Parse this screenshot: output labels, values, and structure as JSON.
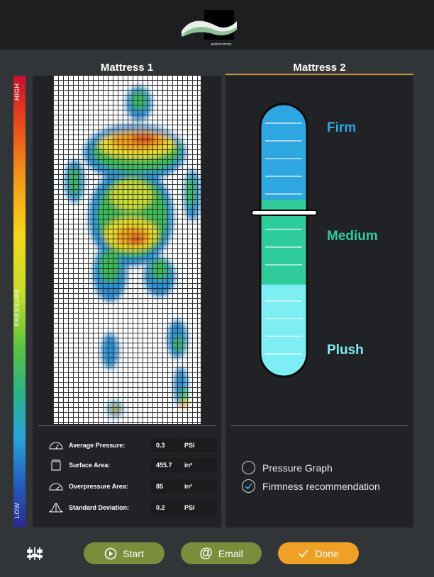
{
  "brand": {
    "logo_text": "BODYFITTER",
    "logo_icon": "bodyfitter-wave-logo"
  },
  "mattress1": {
    "title": "Mattress 1"
  },
  "mattress2": {
    "title": "Mattress 2"
  },
  "legend": {
    "high": "HIGH",
    "pressure": "PRESSURE",
    "low": "LOW"
  },
  "stats": [
    {
      "label": "Average Pressure:",
      "value": "0.3",
      "unit": "PSI",
      "icon": "gauge-icon"
    },
    {
      "label": "Surface Area:",
      "value": "455.7",
      "unit": "in²",
      "icon": "area-icon"
    },
    {
      "label": "Overpressure Area:",
      "value": "85",
      "unit": "in²",
      "icon": "gauge-icon"
    },
    {
      "label": "Standard Deviation:",
      "value": "0.2",
      "unit": "PSI",
      "icon": "bell-curve-icon"
    }
  ],
  "firmness": {
    "levels": [
      "Firm",
      "Medium",
      "Plush"
    ],
    "colors": {
      "firm": "#2ea6e0",
      "medium": "#2ecc9a",
      "plush": "#7eeef5"
    },
    "indicator_level": 0.68
  },
  "options": [
    {
      "label": "Pressure Graph",
      "checked": false
    },
    {
      "label": "Firmness recommendation",
      "checked": true
    }
  ],
  "toolbar": {
    "settings_icon": "sliders-icon",
    "start_label": "Start",
    "email_label": "Email",
    "done_label": "Done",
    "start_color": "#7a8d3a",
    "done_color": "#efa126"
  }
}
